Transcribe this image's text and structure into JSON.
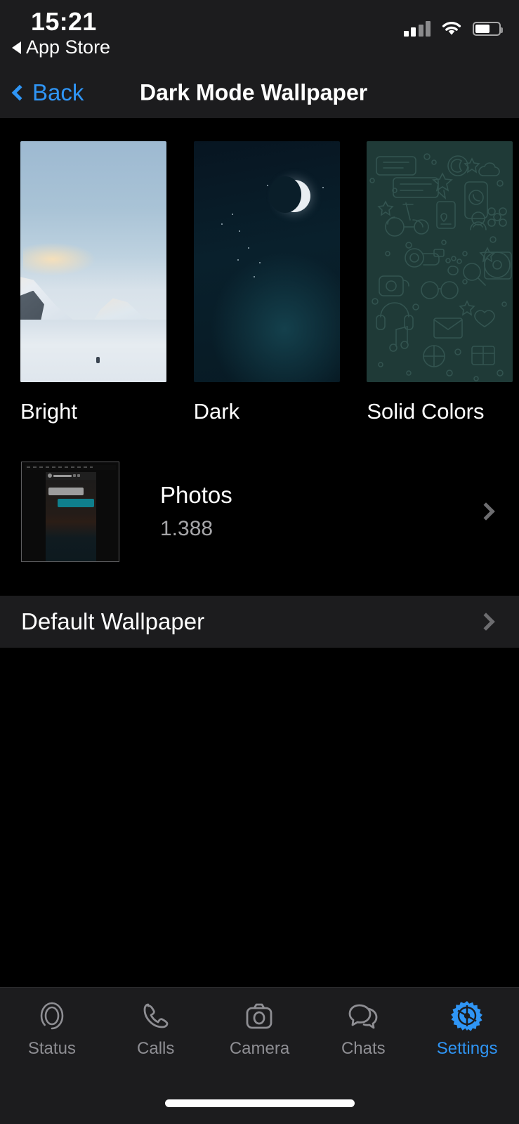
{
  "status_bar": {
    "time": "15:21",
    "return_app": "App Store",
    "return_icon": "back-triangle-icon",
    "signal_icon": "cellular-signal-icon",
    "wifi_icon": "wifi-icon",
    "battery_icon": "battery-icon",
    "battery_level": 62
  },
  "nav_bar": {
    "back_label": "Back",
    "back_icon": "chevron-left-icon",
    "title": "Dark Mode Wallpaper",
    "accent_color": "#2f95f5"
  },
  "wallpaper_grid": [
    {
      "label": "Bright",
      "type": "photo-mountain"
    },
    {
      "label": "Dark",
      "type": "photo-night-moon"
    },
    {
      "label": "Solid Colors",
      "type": "doodle-pattern"
    }
  ],
  "photos_row": {
    "title": "Photos",
    "subtitle": "1.388",
    "thumbnail": "chat-screenshot-thumbnail",
    "chevron_icon": "chevron-right-icon"
  },
  "default_section": {
    "label": "Default Wallpaper",
    "chevron_icon": "chevron-right-icon"
  },
  "tab_bar": {
    "active": "Settings",
    "items": [
      {
        "label": "Status",
        "icon": "status-rings-icon"
      },
      {
        "label": "Calls",
        "icon": "phone-icon"
      },
      {
        "label": "Camera",
        "icon": "camera-icon"
      },
      {
        "label": "Chats",
        "icon": "chat-bubbles-icon"
      },
      {
        "label": "Settings",
        "icon": "gear-icon"
      }
    ]
  },
  "colors": {
    "background": "#000000",
    "surface": "#1c1c1e",
    "accent": "#2f95f5",
    "muted_text": "#8e8e93",
    "doodle_teal": "#1f3a37"
  }
}
